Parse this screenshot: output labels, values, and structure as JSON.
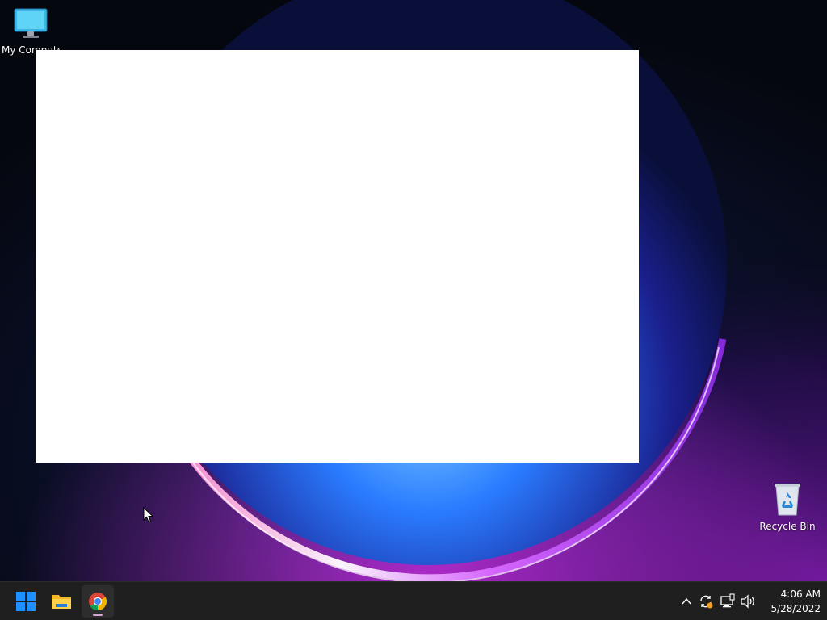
{
  "desktop": {
    "icons": [
      {
        "label": "My Computer",
        "icon": "monitor-icon"
      },
      {
        "label": "Recycle Bin",
        "icon": "recycle-bin-icon"
      }
    ]
  },
  "taskbar": {
    "pinned": [
      {
        "name": "Start",
        "icon": "windows-logo-icon"
      },
      {
        "name": "File Explorer",
        "icon": "folder-icon"
      },
      {
        "name": "Google Chrome",
        "icon": "chrome-icon",
        "running": true
      }
    ],
    "tray": {
      "icons": [
        "chevron-up-icon",
        "sync-icon",
        "network-icon",
        "volume-icon"
      ]
    },
    "clock": {
      "time": "4:06 AM",
      "date": "5/28/2022"
    }
  },
  "colors": {
    "taskbar_bg": "#1f1f1f",
    "accent_windows": "#1e90ff",
    "wallpaper_glow_blue": "#2a8cff",
    "wallpaper_glow_purple": "#b02bd9"
  }
}
